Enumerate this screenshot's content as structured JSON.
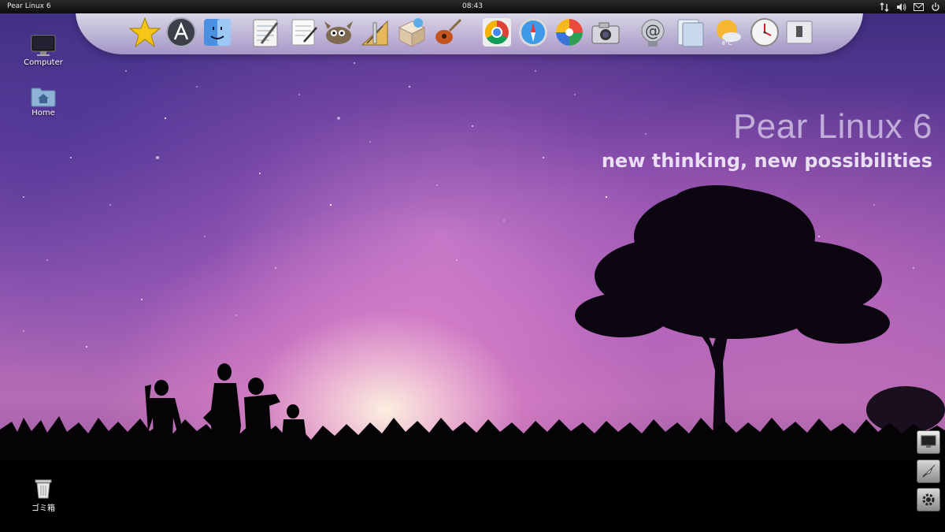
{
  "top_panel": {
    "os_name": "Pear Linux 6",
    "clock": "08:43"
  },
  "dock": {
    "items": [
      {
        "icon": "star-icon"
      },
      {
        "icon": "app-store-icon"
      },
      {
        "icon": "finder-icon"
      },
      {
        "icon": "notepad-icon"
      },
      {
        "icon": "text-editor-icon"
      },
      {
        "icon": "gimp-icon"
      },
      {
        "icon": "geometry-tools-icon"
      },
      {
        "icon": "package-installer-icon"
      },
      {
        "icon": "guitar-icon"
      },
      {
        "icon": "chrome-icon"
      },
      {
        "icon": "safari-icon"
      },
      {
        "icon": "picasa-icon"
      },
      {
        "icon": "camera-icon"
      },
      {
        "icon": "mail-icon"
      },
      {
        "icon": "folder-icon"
      },
      {
        "icon": "weather-icon",
        "temp": "8°C"
      },
      {
        "icon": "clock-icon"
      },
      {
        "icon": "trash-dock-icon"
      }
    ]
  },
  "desktop": {
    "computer_label": "Computer",
    "home_label": "Home",
    "trash_label": "ゴミ箱"
  },
  "wallpaper": {
    "title": "Pear Linux 6",
    "slogan": "new thinking, new possibilities"
  },
  "colors": {
    "panel": "#111111",
    "sky_top": "#3b2d7e",
    "sky_glow": "#fff6e1"
  }
}
